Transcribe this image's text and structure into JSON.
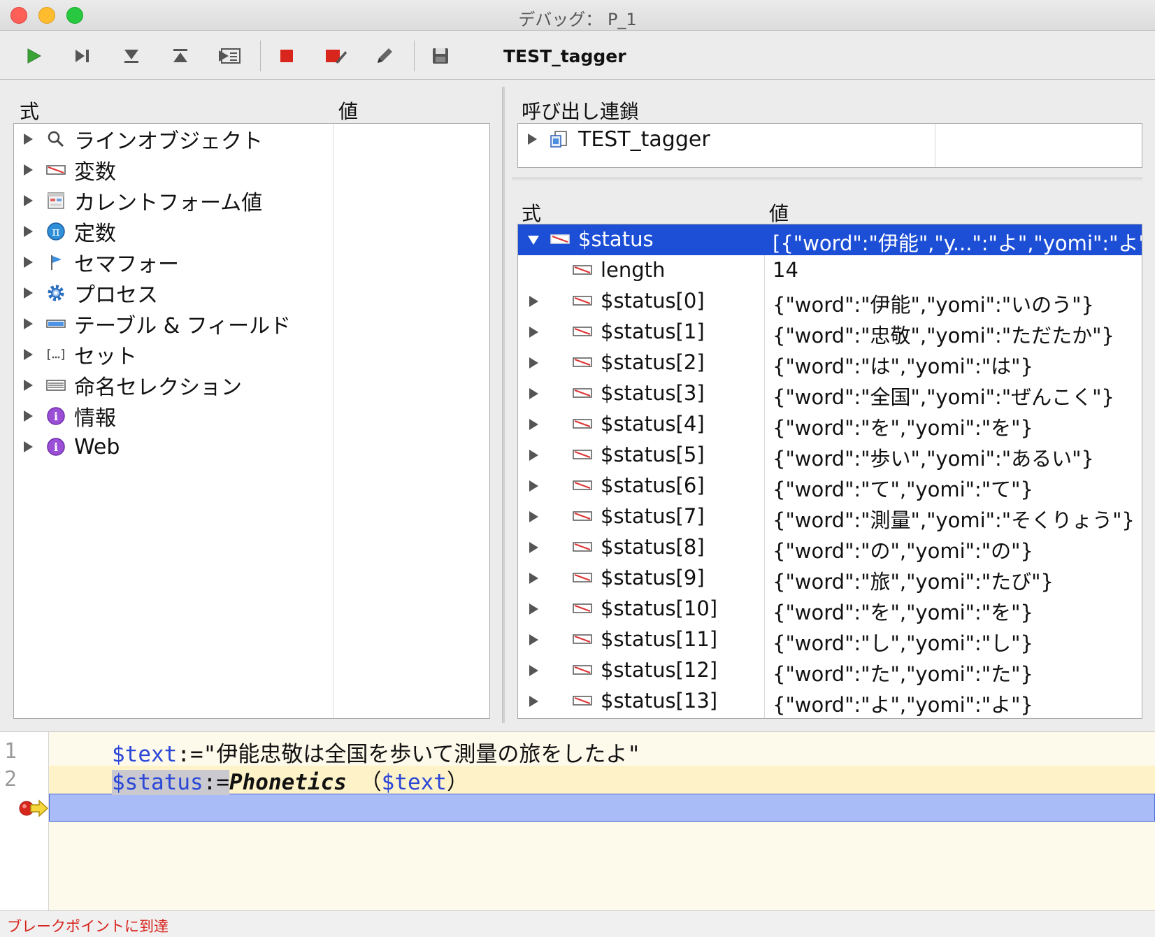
{
  "window": {
    "title": "デバッグ： P_1"
  },
  "toolbar": {
    "buttons": [
      {
        "name": "run-icon"
      },
      {
        "name": "step-over-icon"
      },
      {
        "name": "step-into-icon"
      },
      {
        "name": "step-out-icon"
      },
      {
        "name": "trace-icon"
      },
      {
        "name": "abort-icon"
      },
      {
        "name": "abort-edit-icon"
      },
      {
        "name": "edit-icon"
      },
      {
        "name": "save-icon"
      }
    ],
    "method_name": "TEST_tagger"
  },
  "watch_panel": {
    "col_expression": "式",
    "col_value": "値",
    "items": [
      {
        "label": "ラインオブジェクト",
        "icon": "magnifier-icon"
      },
      {
        "label": "変数",
        "icon": "variable-icon"
      },
      {
        "label": "カレントフォーム値",
        "icon": "form-icon"
      },
      {
        "label": "定数",
        "icon": "pi-icon"
      },
      {
        "label": "セマフォー",
        "icon": "flag-icon"
      },
      {
        "label": "プロセス",
        "icon": "gear-icon"
      },
      {
        "label": "テーブル & フィールド",
        "icon": "table-icon"
      },
      {
        "label": "セット",
        "icon": "set-icon"
      },
      {
        "label": "命名セレクション",
        "icon": "selection-icon"
      },
      {
        "label": "情報",
        "icon": "info-icon"
      },
      {
        "label": "Web",
        "icon": "info-icon"
      }
    ]
  },
  "call_chain": {
    "title": "呼び出し連鎖",
    "items": [
      {
        "label": "TEST_tagger",
        "icon": "method-icon"
      }
    ]
  },
  "local_vars": {
    "col_expression": "式",
    "col_value": "値",
    "rows": [
      {
        "name": "$status",
        "value": "[{\"word\":\"伊能\",\"y...\":\"よ\",\"yomi\":\"よ\"}]"
      },
      {
        "name": "length",
        "value": "14"
      },
      {
        "name": "$status[0]",
        "value": "{\"word\":\"伊能\",\"yomi\":\"いのう\"}"
      },
      {
        "name": "$status[1]",
        "value": "{\"word\":\"忠敬\",\"yomi\":\"ただたか\"}"
      },
      {
        "name": "$status[2]",
        "value": "{\"word\":\"は\",\"yomi\":\"は\"}"
      },
      {
        "name": "$status[3]",
        "value": "{\"word\":\"全国\",\"yomi\":\"ぜんこく\"}"
      },
      {
        "name": "$status[4]",
        "value": "{\"word\":\"を\",\"yomi\":\"を\"}"
      },
      {
        "name": "$status[5]",
        "value": "{\"word\":\"歩い\",\"yomi\":\"あるい\"}"
      },
      {
        "name": "$status[6]",
        "value": "{\"word\":\"て\",\"yomi\":\"て\"}"
      },
      {
        "name": "$status[7]",
        "value": "{\"word\":\"測量\",\"yomi\":\"そくりょう\"}"
      },
      {
        "name": "$status[8]",
        "value": "{\"word\":\"の\",\"yomi\":\"の\"}"
      },
      {
        "name": "$status[9]",
        "value": "{\"word\":\"旅\",\"yomi\":\"たび\"}"
      },
      {
        "name": "$status[10]",
        "value": "{\"word\":\"を\",\"yomi\":\"を\"}"
      },
      {
        "name": "$status[11]",
        "value": "{\"word\":\"し\",\"yomi\":\"し\"}"
      },
      {
        "name": "$status[12]",
        "value": "{\"word\":\"た\",\"yomi\":\"た\"}"
      },
      {
        "name": "$status[13]",
        "value": "{\"word\":\"よ\",\"yomi\":\"よ\"}"
      }
    ]
  },
  "editor": {
    "line_numbers": [
      "1",
      "2"
    ],
    "line1": {
      "var": "$text",
      "op": ":=",
      "str": "\"伊能忠敬は全国を歩いて測量の旅をしたよ\""
    },
    "line2": {
      "var": "$status",
      "op": ":=",
      "func": "Phonetics",
      "open": "（",
      "arg": "$text",
      "close": "）"
    }
  },
  "status": {
    "message": "ブレークポイントに到達"
  },
  "colors": {
    "selection": "#1d4fd6",
    "current_line": "#a9bcf8",
    "status_text": "#d8231d"
  }
}
